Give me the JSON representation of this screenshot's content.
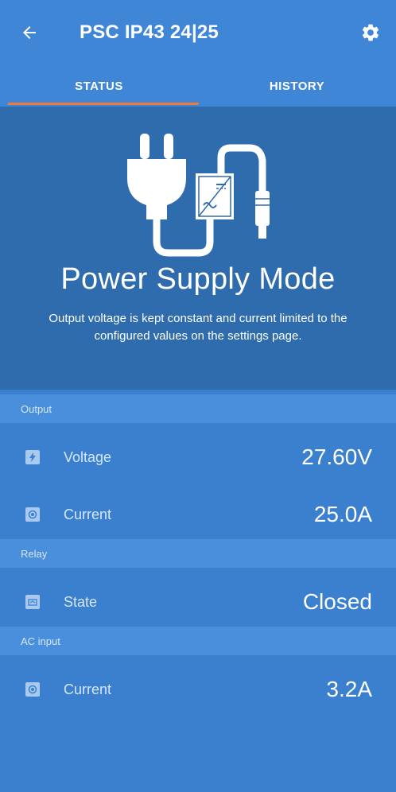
{
  "header": {
    "title": "PSC IP43 24|25",
    "back_icon": "arrow-left-icon",
    "settings_icon": "gear-icon"
  },
  "tabs": [
    {
      "label": "STATUS",
      "active": true
    },
    {
      "label": "HISTORY",
      "active": false
    }
  ],
  "hero": {
    "illustration_icon": "plug-charger-icon",
    "title": "Power Supply Mode",
    "description": "Output voltage is kept constant and current limited to the configured values on the settings page."
  },
  "sections": {
    "output": {
      "header": "Output",
      "rows": [
        {
          "label": "Voltage",
          "value": "27.60V",
          "icon": "bolt-icon"
        },
        {
          "label": "Current",
          "value": "25.0A",
          "icon": "current-icon"
        }
      ]
    },
    "relay": {
      "header": "Relay",
      "rows": [
        {
          "label": "State",
          "value": "Closed",
          "icon": "relay-icon"
        }
      ]
    },
    "ac_input": {
      "header": "AC input",
      "rows": [
        {
          "label": "Current",
          "value": "3.2A",
          "icon": "current-icon"
        }
      ]
    }
  },
  "colors": {
    "accent": "#f07a3a",
    "appbar": "#3f87d6",
    "hero": "#2e6cae",
    "body": "#3a80cf",
    "section_header": "#4a8fdb"
  }
}
